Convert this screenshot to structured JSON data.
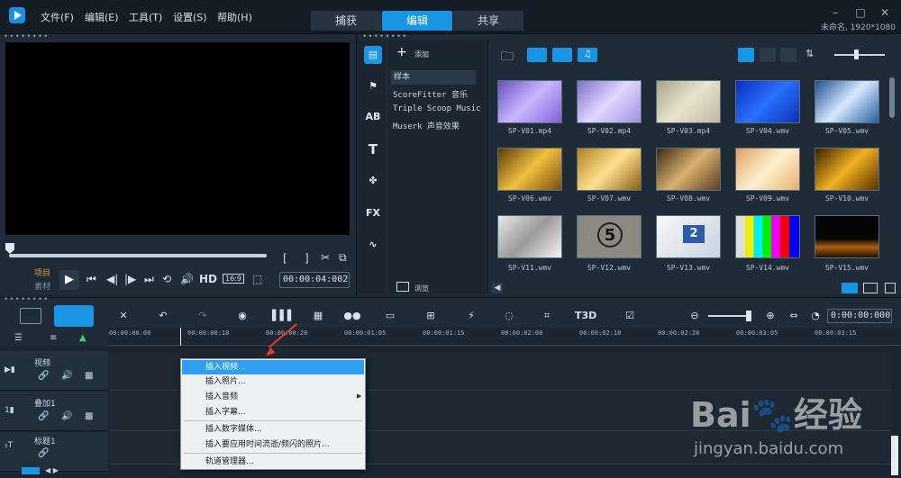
{
  "menu": {
    "file": "文件(F)",
    "edit": "编辑(E)",
    "tools": "工具(T)",
    "settings": "设置(S)",
    "help": "帮助(H)"
  },
  "tabs": {
    "capture": "捕获",
    "edit": "编辑",
    "share": "共享"
  },
  "project_info": "未命名, 1920*1080",
  "player": {
    "project_label": "项目",
    "material_label": "素材",
    "hd": "HD",
    "ratio": "16:9",
    "timecode": "00:00:04:002"
  },
  "library": {
    "add": "添加",
    "browse": "浏览",
    "folders": [
      "样本",
      "ScoreFitter 音乐",
      "Triple Scoop Music",
      "Muserk 声音效果"
    ],
    "thumbs": [
      "SP-V01.mp4",
      "SP-V02.mp4",
      "SP-V03.mp4",
      "SP-V04.wmv",
      "SP-V05.wmv",
      "SP-V06.wmv",
      "SP-V07.wmv",
      "SP-V08.wmv",
      "SP-V09.wmv",
      "SP-V10.wmv",
      "SP-V11.wmv",
      "SP-V12.wmv",
      "SP-V13.wmv",
      "SP-V14.wmv",
      "SP-V15.wmv"
    ],
    "num5": "5",
    "num2": "2",
    "fx": "FX"
  },
  "timeline": {
    "time": "0:00:00:000",
    "ticks": [
      "00:00:00:00",
      "00:00:00:10",
      "00:00:00:20",
      "00:00:01:05",
      "00:00:01:15",
      "00:00:02:00",
      "00:00:02:10",
      "00:00:02:20",
      "00:00:03:05",
      "00:00:03:15"
    ],
    "tracks": [
      "视频",
      "叠加1",
      "标题1"
    ],
    "t3d": "T3D"
  },
  "context_menu": [
    "插入视频...",
    "插入照片...",
    "插入音频",
    "插入字幕...",
    "插入数字媒体...",
    "插入要应用时间流逝/频闪的照片...",
    "轨道管理器..."
  ],
  "watermark": {
    "logo": "Bai🐾经验",
    "url": "jingyan.baidu.com"
  }
}
